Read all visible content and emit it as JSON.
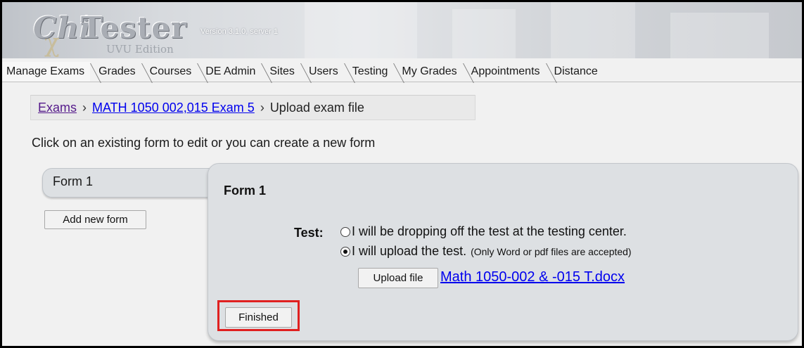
{
  "app": {
    "logo_chi": "Chi",
    "logo_tester": "Tester",
    "version": "Version 3.1.0, server 1",
    "edition": "UVU Edition",
    "chi_glyph": "χ"
  },
  "tabs": [
    {
      "label": "Manage Exams",
      "active": true
    },
    {
      "label": "Grades"
    },
    {
      "label": "Courses"
    },
    {
      "label": "DE Admin"
    },
    {
      "label": "Sites"
    },
    {
      "label": "Users"
    },
    {
      "label": "Testing"
    },
    {
      "label": "My Grades"
    },
    {
      "label": "Appointments"
    },
    {
      "label": "Distance"
    }
  ],
  "breadcrumb": {
    "items": [
      "Exams",
      "MATH 1050 002,015 Exam 5",
      "Upload exam file"
    ],
    "separator": "›"
  },
  "instructions": "Click on an existing form to edit or you can create a new form",
  "forms": {
    "form_tab_label": "Form 1",
    "add_button": "Add new form"
  },
  "panel": {
    "title": "Form 1",
    "test_label": "Test:",
    "option_dropoff": "I will be dropping off the test at the testing center.",
    "option_upload": "I will upload the test.",
    "option_upload_note": "(Only Word or pdf files are accepted)",
    "selected_option": "upload",
    "upload_button": "Upload file",
    "file_name": "Math 1050-002 & -015 T.docx",
    "finished_button": "Finished"
  },
  "colors": {
    "highlight_outline": "#e02020",
    "link": "#0000ee",
    "visited_link": "#551a8b"
  }
}
